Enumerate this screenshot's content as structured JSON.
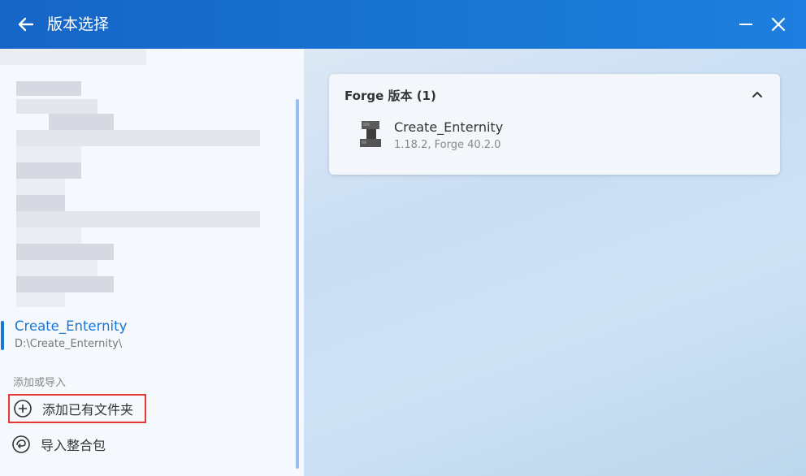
{
  "window": {
    "title": "版本选择"
  },
  "sidebar": {
    "selected_instance": {
      "name": "Create_Enternity",
      "path": "D:\\Create_Enternity\\"
    },
    "section_label": "添加或导入",
    "actions": [
      {
        "label": "添加已有文件夹",
        "icon": "plus-circle-icon"
      },
      {
        "label": "导入整合包",
        "icon": "package-import-icon"
      }
    ]
  },
  "main": {
    "group": {
      "header": "Forge 版本 (1)",
      "items": [
        {
          "name": "Create_Enternity",
          "version": "1.18.2, Forge 40.2.0",
          "icon": "anvil-icon"
        }
      ]
    }
  },
  "colors": {
    "titlebar": "#1976d2",
    "accent": "#1976d2",
    "highlight_border": "#e53935"
  }
}
